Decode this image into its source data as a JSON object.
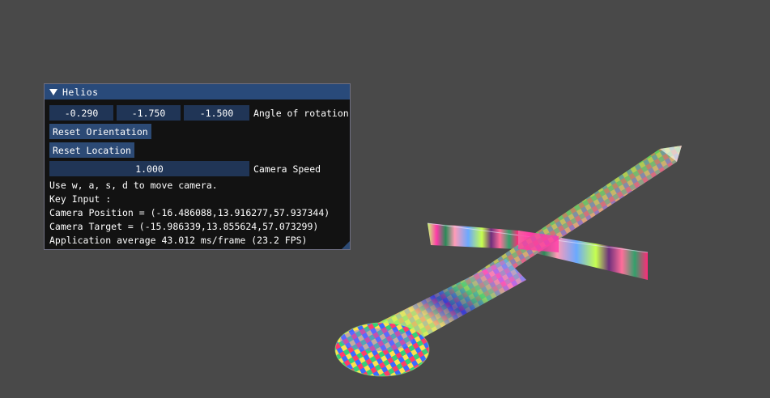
{
  "window": {
    "title": "Helios",
    "angle": {
      "values": [
        "-0.290",
        "-1.750",
        "-1.500"
      ],
      "label": "Angle of rotation"
    },
    "reset_orientation_label": "Reset Orientation",
    "reset_location_label": "Reset Location",
    "speed": {
      "value": "1.000",
      "label": "Camera Speed"
    },
    "help_text": "Use w, a, s, d to move camera.",
    "key_input": "Key Input :",
    "camera_position": "Camera Position = (-16.486088,13.916277,57.937344)",
    "camera_target": "Camera Target = (-15.986339,13.855624,57.073299)",
    "perf": "Application average 43.012 ms/frame (23.2 FPS)"
  },
  "scene": {
    "background": "#494949",
    "object": "sword"
  }
}
